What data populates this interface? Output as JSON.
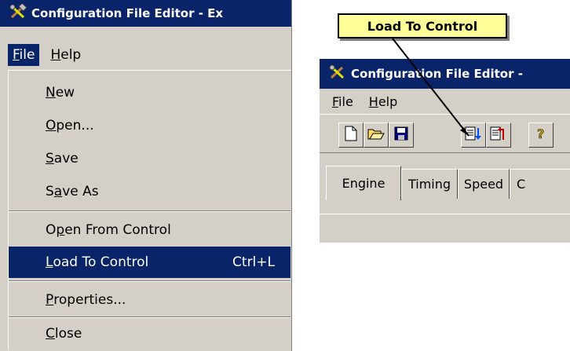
{
  "left_window": {
    "title": "Configuration File Editor - Ex",
    "menu": [
      {
        "label": "File",
        "accel": "F",
        "rest": "ile"
      },
      {
        "label": "Help",
        "accel": "H",
        "rest": "elp"
      }
    ],
    "dropdown": [
      {
        "pre": "",
        "accel": "N",
        "rest": "ew",
        "shortcut": ""
      },
      {
        "pre": "",
        "accel": "O",
        "rest": "pen...",
        "shortcut": ""
      },
      {
        "pre": "",
        "accel": "S",
        "rest": "ave",
        "shortcut": ""
      },
      {
        "pre": "S",
        "accel": "a",
        "rest": "ve As",
        "shortcut": ""
      },
      {
        "pre": "O",
        "accel": "p",
        "rest": "en From Control",
        "shortcut": ""
      },
      {
        "pre": "",
        "accel": "L",
        "rest": "oad To Control",
        "shortcut": "Ctrl+L"
      },
      {
        "pre": "",
        "accel": "P",
        "rest": "roperties...",
        "shortcut": ""
      },
      {
        "pre": "",
        "accel": "C",
        "rest": "lose",
        "shortcut": ""
      }
    ]
  },
  "callout": {
    "text": "Load To Control"
  },
  "right_window": {
    "title": "Configuration File Editor -",
    "menu": [
      {
        "accel": "F",
        "rest": "ile"
      },
      {
        "accel": "H",
        "rest": "elp"
      }
    ],
    "toolbar": [
      "new-file-icon",
      "open-folder-icon",
      "save-disk-icon",
      "load-to-control-icon",
      "open-from-control-icon",
      "help-icon"
    ],
    "tabs": [
      "Engine",
      "Timing",
      "Speed",
      "C"
    ]
  },
  "colors": {
    "face": "#d4d0c8",
    "highlight": "#0a246a",
    "callout": "#ffff99"
  }
}
